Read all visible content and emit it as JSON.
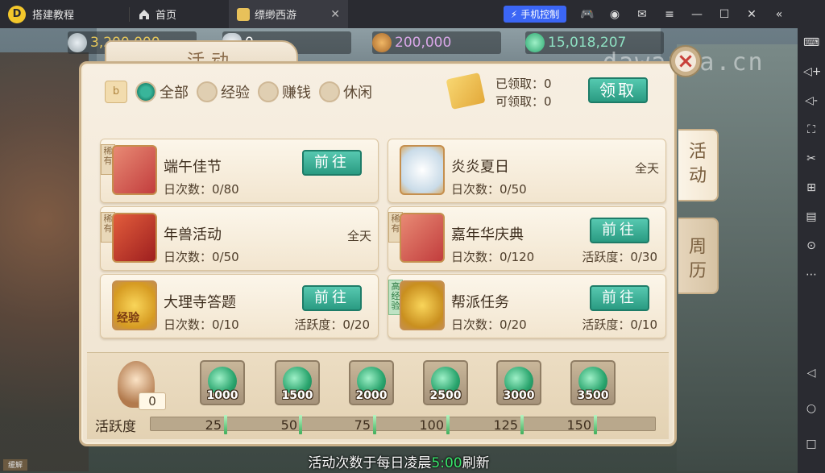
{
  "titlebar": {
    "app_name": "搭建教程",
    "home_tab": "首页",
    "game_tab": "缥缈西游",
    "phone_control": "手机控制"
  },
  "currencies": [
    {
      "value": "3,200,000",
      "color": "#e6c75a"
    },
    {
      "value": "0",
      "color": "#ffffff"
    },
    {
      "value": "200,000",
      "color": "#d9a7e8"
    },
    {
      "value": "15,018,207",
      "color": "#8ee0c2"
    }
  ],
  "watermark": "dawanka.cn",
  "panel": {
    "title": "活动",
    "side_tabs": [
      "活动",
      "周历"
    ],
    "close": "×"
  },
  "filters": {
    "book_icon": "b",
    "options": [
      {
        "label": "全部",
        "checked": true
      },
      {
        "label": "经验",
        "checked": false
      },
      {
        "label": "赚钱",
        "checked": false
      },
      {
        "label": "休闲",
        "checked": false
      }
    ]
  },
  "claim": {
    "claimed": "已领取：0",
    "available": "可领取：0",
    "button": "领取"
  },
  "activities": [
    {
      "name": "端午佳节",
      "ribbon": "稀有",
      "daily": "日次数：0/80",
      "button": "前往"
    },
    {
      "name": "炎炎夏日",
      "daily": "日次数：0/50",
      "time": "全天"
    },
    {
      "name": "年兽活动",
      "ribbon": "稀有",
      "daily": "日次数：0/50",
      "time": "全天"
    },
    {
      "name": "嘉年华庆典",
      "ribbon": "稀有",
      "daily": "日次数：0/120",
      "active": "活跃度：0/30",
      "button": "前往"
    },
    {
      "name": "大理寺答题",
      "daily": "日次数：0/10",
      "active": "活跃度：0/20",
      "button": "前往",
      "icon_text": "经验"
    },
    {
      "name": "帮派任务",
      "ribbon": "高经验",
      "daily": "日次数：0/20",
      "active": "活跃度：0/10",
      "button": "前往"
    }
  ],
  "rewards": {
    "mascot_count": "0",
    "items": [
      "1000",
      "1500",
      "2000",
      "2500",
      "3000",
      "3500"
    ],
    "activity_label": "活跃度",
    "activity_progress": 0,
    "ticks": [
      "25",
      "50",
      "75",
      "100",
      "125",
      "150"
    ]
  },
  "refresh": {
    "prefix": "活动次数于每日凌晨",
    "time": "5:00",
    "suffix": "刷新"
  },
  "corner_tag": "缓解"
}
